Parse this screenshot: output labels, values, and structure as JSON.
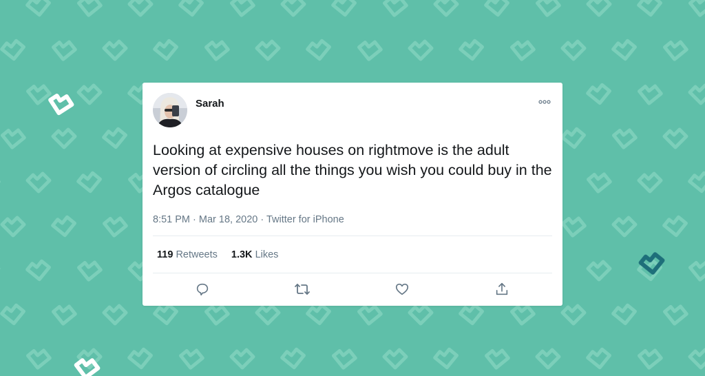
{
  "background": {
    "color": "#5fbfa9",
    "pattern_icon": "heart-outline-icon",
    "accent_colors": [
      "#ffffff",
      "#1e6f7a"
    ]
  },
  "tweet": {
    "author_name": "Sarah",
    "avatar_icon": "profile-photo",
    "more_icon": "more-options-icon",
    "text": "Looking at expensive houses on rightmove is the adult version of circling all the things you wish you could buy in the Argos catalogue",
    "meta": "8:51 PM · Mar 18, 2020 · Twitter for iPhone",
    "stats": {
      "retweets_count": "119",
      "retweets_label": "Retweets",
      "likes_count": "1.3K",
      "likes_label": "Likes"
    },
    "actions": [
      {
        "icon": "reply-icon"
      },
      {
        "icon": "retweet-icon"
      },
      {
        "icon": "like-icon"
      },
      {
        "icon": "share-icon"
      }
    ],
    "text_color": "#14171a",
    "secondary_color": "#657786",
    "icon_color": "#657786"
  }
}
